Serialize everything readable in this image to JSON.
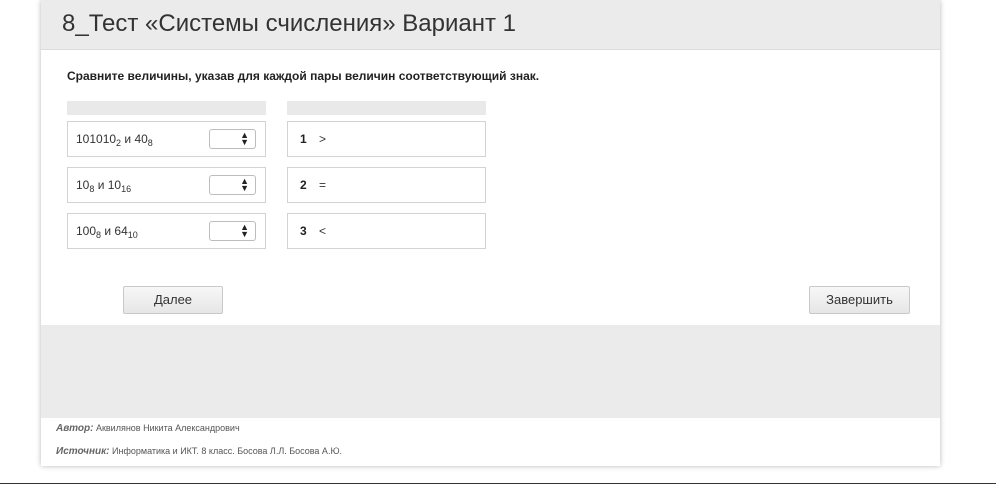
{
  "header": {
    "title": "8_Тест «Системы счисления» Вариант 1"
  },
  "question": {
    "instruction": "Сравните величины, указав для каждой пары величин соответствующий знак."
  },
  "left_items": [
    {
      "a": "101010",
      "a_sub": "2",
      "conj": " и ",
      "b": "40",
      "b_sub": "8",
      "select_value": ""
    },
    {
      "a": "10",
      "a_sub": "8",
      "conj": " и ",
      "b": "10",
      "b_sub": "16",
      "select_value": ""
    },
    {
      "a": "100",
      "a_sub": "8",
      "conj": " и ",
      "b": "64",
      "b_sub": "10",
      "select_value": ""
    }
  ],
  "right_items": [
    {
      "num": "1",
      "symbol": ">"
    },
    {
      "num": "2",
      "symbol": "="
    },
    {
      "num": "3",
      "symbol": "<"
    }
  ],
  "buttons": {
    "next": "Далее",
    "finish": "Завершить"
  },
  "footer": {
    "author_label": "Автор:",
    "author": "Аквилянов Никита Александрович",
    "source_label": "Источник:",
    "source": "Информатика и ИКТ. 8 класс. Босова Л.Л. Босова А.Ю."
  }
}
